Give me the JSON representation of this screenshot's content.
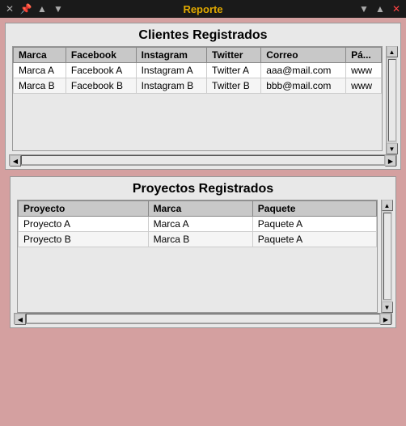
{
  "titlebar": {
    "title": "Reporte",
    "icons": {
      "left": [
        "✕",
        "📌",
        "▲",
        "▼"
      ],
      "right": [
        "▼",
        "▲",
        "✕"
      ]
    }
  },
  "clientes": {
    "title": "Clientes Registrados",
    "columns": [
      "Marca",
      "Facebook",
      "Instagram",
      "Twitter",
      "Correo",
      "Pá..."
    ],
    "rows": [
      [
        "Marca A",
        "Facebook A",
        "Instagram A",
        "Twitter A",
        "aaa@mail.com",
        "www"
      ],
      [
        "Marca B",
        "Facebook B",
        "Instagram B",
        "Twitter B",
        "bbb@mail.com",
        "www"
      ]
    ]
  },
  "proyectos": {
    "title": "Proyectos Registrados",
    "columns": [
      "Proyecto",
      "Marca",
      "Paquete"
    ],
    "rows": [
      [
        "Proyecto A",
        "Marca A",
        "Paquete A"
      ],
      [
        "Proyecto B",
        "Marca B",
        "Paquete A"
      ]
    ]
  }
}
